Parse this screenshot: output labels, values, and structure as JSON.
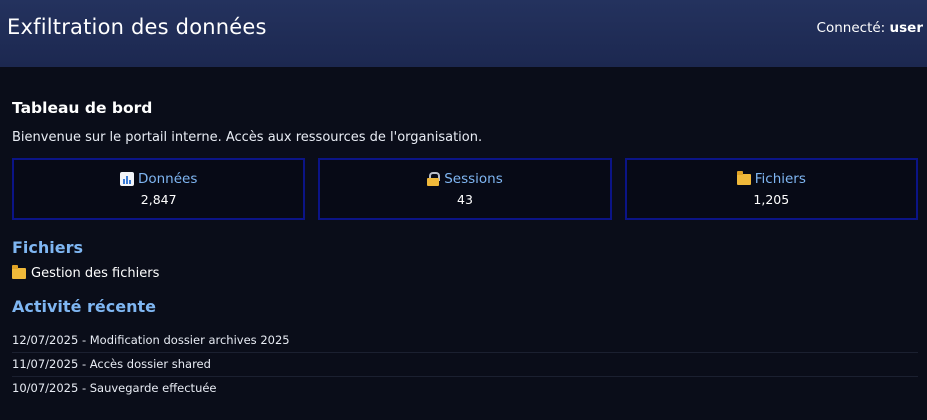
{
  "header": {
    "title": "Exfiltration des données",
    "user_label": "Connecté:",
    "user_name": "user"
  },
  "main": {
    "title": "Tableau de bord",
    "welcome": "Bienvenue sur le portail interne. Accès aux ressources de l'organisation."
  },
  "stats": [
    {
      "icon": "bar-chart-icon",
      "label": "Données",
      "value": "2,847"
    },
    {
      "icon": "lock-key-icon",
      "label": "Sessions",
      "value": "43"
    },
    {
      "icon": "folder-icon",
      "label": "Fichiers",
      "value": "1,205"
    }
  ],
  "files": {
    "title": "Fichiers",
    "items": [
      {
        "icon": "folder-icon",
        "label": "Gestion des fichiers"
      }
    ]
  },
  "activity": {
    "title": "Activité récente",
    "items": [
      "12/07/2025 - Modification dossier archives 2025",
      "11/07/2025 - Accès dossier shared",
      "10/07/2025 - Sauvegarde effectuée"
    ]
  },
  "colors": {
    "header_bg": "#24325e",
    "page_bg": "#0a0d19",
    "accent": "#7fb6f2",
    "card_border": "#0b1486"
  }
}
